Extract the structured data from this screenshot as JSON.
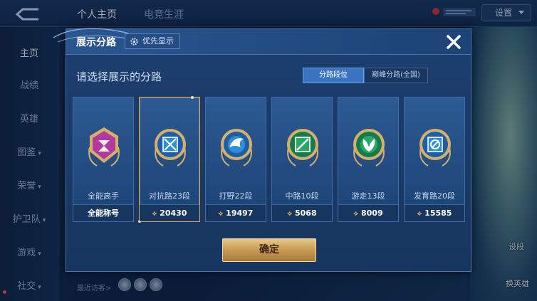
{
  "topbar": {
    "tabs": [
      "个人主页",
      "电竞生涯"
    ],
    "settings_label": "设置"
  },
  "sidebar": {
    "items": [
      {
        "label": "主页",
        "dropdown": false
      },
      {
        "label": "战绩",
        "dropdown": false
      },
      {
        "label": "英雄",
        "dropdown": false
      },
      {
        "label": "图鉴",
        "dropdown": true
      },
      {
        "label": "荣誉",
        "dropdown": true
      },
      {
        "label": "护卫队",
        "dropdown": true
      },
      {
        "label": "游戏",
        "dropdown": true
      },
      {
        "label": "社交",
        "dropdown": true
      }
    ]
  },
  "bottom": {
    "visitors_label": "最近访客>"
  },
  "right_panel": {
    "label_top": "设段",
    "label_bottom": "换英雄"
  },
  "modal": {
    "title": "展示分路",
    "priority_label": "优先显示",
    "prompt": "请选择展示的分路",
    "segments": [
      {
        "label": "分路段位",
        "active": true
      },
      {
        "label": "巅峰分路(全国)",
        "active": false
      }
    ],
    "cards": [
      {
        "name": "全能高手",
        "footer": "全能称号",
        "points": null,
        "icon": "all-round-emblem-icon",
        "color": "#b33a9a",
        "selected": false
      },
      {
        "name": "对抗路23段",
        "footer": "20430",
        "points": true,
        "icon": "clash-lane-emblem-icon",
        "color": "#2f8fd6",
        "selected": true
      },
      {
        "name": "打野22段",
        "footer": "19497",
        "points": true,
        "icon": "jungle-emblem-icon",
        "color": "#2f8fd6",
        "selected": false
      },
      {
        "name": "中路10段",
        "footer": "5068",
        "points": true,
        "icon": "mid-lane-emblem-icon",
        "color": "#2aa86a",
        "selected": false
      },
      {
        "name": "游走13段",
        "footer": "8009",
        "points": true,
        "icon": "roam-emblem-icon",
        "color": "#2aa86a",
        "selected": false
      },
      {
        "name": "发育路20段",
        "footer": "15585",
        "points": true,
        "icon": "farm-lane-emblem-icon",
        "color": "#2f8fd6",
        "selected": false
      }
    ],
    "confirm_label": "确定"
  },
  "colors": {
    "accent_gold": "#d9a45b",
    "panel_blue": "#1d3f70",
    "active_tab": "#3a73c4"
  }
}
